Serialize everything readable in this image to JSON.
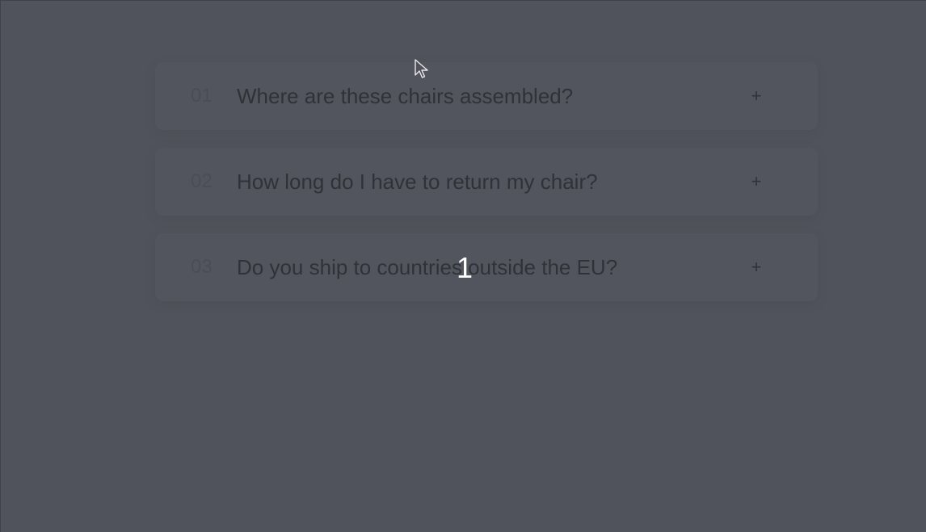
{
  "faq": {
    "items": [
      {
        "number": "01",
        "question": "Where are these chairs assembled?",
        "toggle": "+"
      },
      {
        "number": "02",
        "question": "How long do I have to return my chair?",
        "toggle": "+"
      },
      {
        "number": "03",
        "question": "Do you ship to countries outside the EU?",
        "toggle": "+"
      }
    ]
  },
  "overlay": {
    "number": "1"
  },
  "icons": {
    "cursor": "mouse-pointer-icon",
    "toggle": "plus-icon"
  }
}
